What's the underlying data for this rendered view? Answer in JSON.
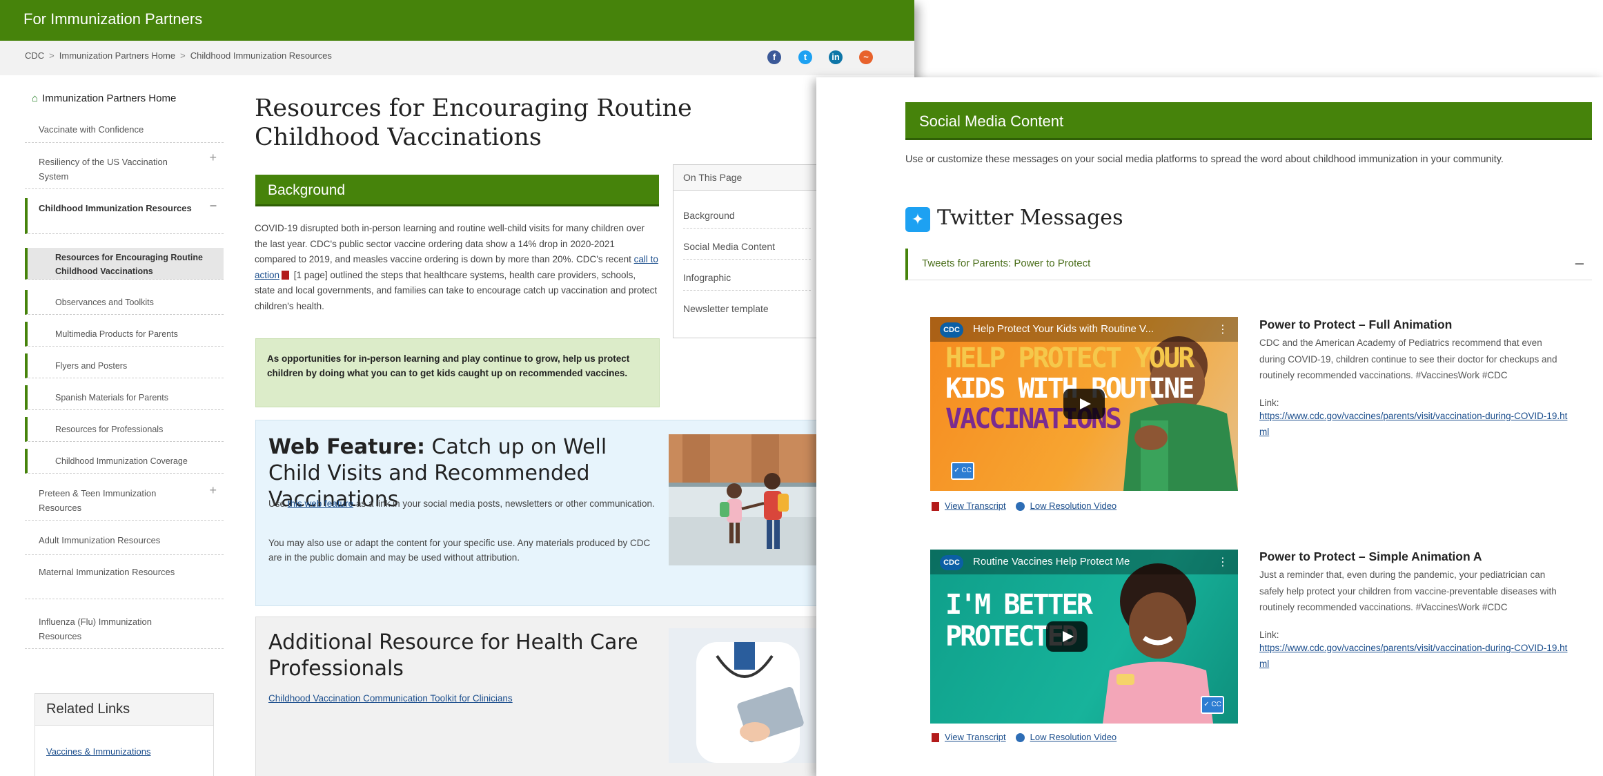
{
  "back": {
    "banner": "For Immunization Partners",
    "breadcrumb": [
      "CDC",
      "Immunization Partners Home",
      "Childhood Immunization Resources"
    ],
    "social_icons": [
      "facebook-icon",
      "twitter-icon",
      "linkedin-icon",
      "syndicate-icon"
    ],
    "nav": {
      "home": "Immunization Partners Home",
      "items": [
        {
          "label": "Vaccinate with Confidence"
        },
        {
          "label": "Resiliency of the US Vaccination System",
          "toggle": "+"
        },
        {
          "label": "Childhood Immunization Resources",
          "toggle": "–"
        },
        {
          "label": "Preteen & Teen Immunization Resources",
          "toggle": "+"
        },
        {
          "label": "Adult Immunization Resources"
        },
        {
          "label": "Maternal Immunization Resources"
        },
        {
          "label": "Influenza (Flu) Immunization Resources"
        }
      ],
      "subitems": [
        "Resources for Encouraging Routine Childhood Vaccinations",
        "Observances and Toolkits",
        "Multimedia Products for Parents",
        "Flyers and Posters",
        "Spanish Materials for Parents",
        "Resources for Professionals",
        "Childhood Immunization Coverage"
      ]
    },
    "related": {
      "title": "Related Links",
      "link": "Vaccines & Immunizations"
    },
    "title": "Resources for Encouraging Routine Childhood Vaccinations",
    "background": {
      "heading": "Background",
      "text_a": "COVID-19 disrupted both in-person learning and routine well-child visits for many children over the last year. CDC's public sector vaccine ordering data show a 14% drop in 2020-2021 compared to 2019, and measles vaccine ordering is down by more than 20%. CDC's recent ",
      "link": "call to action",
      "text_b": " [1 page] outlined the steps that healthcare systems, health care providers, schools, state and local governments, and families can take to encourage catch up vaccination and protect children's health."
    },
    "callout": "As opportunities for in-person learning and play continue to grow, help us protect children by doing what you can to get kids caught up on recommended vaccines.",
    "on_this_page": {
      "title": "On This Page",
      "items": [
        "Background",
        "Social Media Content",
        "Infographic",
        "Newsletter template"
      ]
    },
    "feature": {
      "label": "Web Feature:",
      "title": " Catch up on Well Child Visits and Recommended Vaccinations",
      "p1_a": "Use ",
      "p1_link": "this web feature",
      "p1_b": " as a link in your social media posts, newsletters or other communication.",
      "p2": "You may also use or adapt the content for your specific use. Any materials produced by CDC are in the public domain and may be used without attribution."
    },
    "hcp": {
      "title": "Additional Resource for Health Care Professionals",
      "link": "Childhood Vaccination Communication Toolkit for Clinicians"
    }
  },
  "front": {
    "heading": "Social Media Content",
    "intro": "Use or customize these messages on your social media platforms to spread the word about childhood immunization in your community.",
    "twitter_title": "Twitter Messages",
    "accordion": {
      "title": "Tweets for Parents: Power to Protect",
      "toggle": "–"
    },
    "videos": [
      {
        "logo": "CDC",
        "video_title": "Help Protect Your Kids with Routine V...",
        "art_lines": [
          "HELP PROTECT YOUR",
          "KIDS WITH ROUTINE",
          "VACCINATIONS"
        ],
        "cc": "✓ CC",
        "heading": "Power to Protect – Full Animation",
        "body": "CDC and the American Academy of Pediatrics recommend that even during COVID-19, children continue to see their doctor for checkups and routinely recommended vaccinations. #VaccinesWork #CDC",
        "link_label": "Link:",
        "url": "https://www.cdc.gov/vaccines/parents/visit/vaccination-during-COVID-19.html",
        "transcript": "View Transcript",
        "lowres": "Low Resolution Video"
      },
      {
        "logo": "CDC",
        "video_title": "Routine Vaccines Help Protect Me",
        "art_lines": [
          "I'M BETTER",
          "PROTECTED"
        ],
        "cc": "✓ CC",
        "heading": "Power to Protect – Simple Animation A",
        "body": "Just a reminder that, even during the pandemic, your pediatrician can safely help protect your children from vaccine-preventable diseases with routinely recommended vaccinations. #VaccinesWork #CDC",
        "link_label": "Link:",
        "url": "https://www.cdc.gov/vaccines/parents/visit/vaccination-during-COVID-19.html",
        "transcript": "View Transcript",
        "lowres": "Low Resolution Video"
      }
    ]
  },
  "colors": {
    "brand_green": "#46830b",
    "link_blue": "#1a4d8c",
    "callout_green": "#dcecc9",
    "feature_blue": "#e7f4fc"
  }
}
